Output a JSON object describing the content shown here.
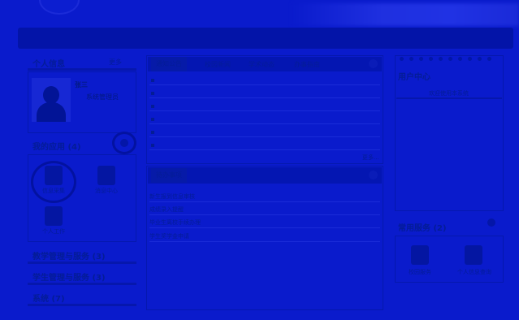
{
  "header": {},
  "sidebar": {
    "personal_info_title": "个人信息",
    "personal_info_more": "更多",
    "user_name": "张三",
    "user_role": "系统管理员",
    "my_apps_title": "我的应用",
    "my_apps_count": "(4)",
    "apps": [
      {
        "label": "信息采集"
      },
      {
        "label": "消息中心"
      },
      {
        "label": "个人工作"
      }
    ],
    "menu": [
      {
        "label": "教学管理与服务",
        "count": "(3)"
      },
      {
        "label": "学生管理与服务",
        "count": "(3)"
      },
      {
        "label": "系统",
        "count": "(7)"
      }
    ]
  },
  "news": {
    "tabs": [
      "通知公告",
      "校园新闻",
      "学术动态",
      "办事指南"
    ],
    "more_label": "更多...",
    "rows": [
      "",
      "",
      "",
      "",
      "",
      ""
    ]
  },
  "todo": {
    "tab_label": "待办事项",
    "items": [
      "新生报到信息审核",
      "成绩录入提醒",
      "毕业生离校手续办理",
      "学生奖学金申请"
    ]
  },
  "right": {
    "user_center_title": "用户中心",
    "user_center_subtitle": "欢迎使用本系统",
    "common_services_title": "常用服务",
    "common_services_count": "(2)",
    "services": [
      {
        "label": "校园服务"
      },
      {
        "label": "个人信息查询"
      }
    ]
  }
}
